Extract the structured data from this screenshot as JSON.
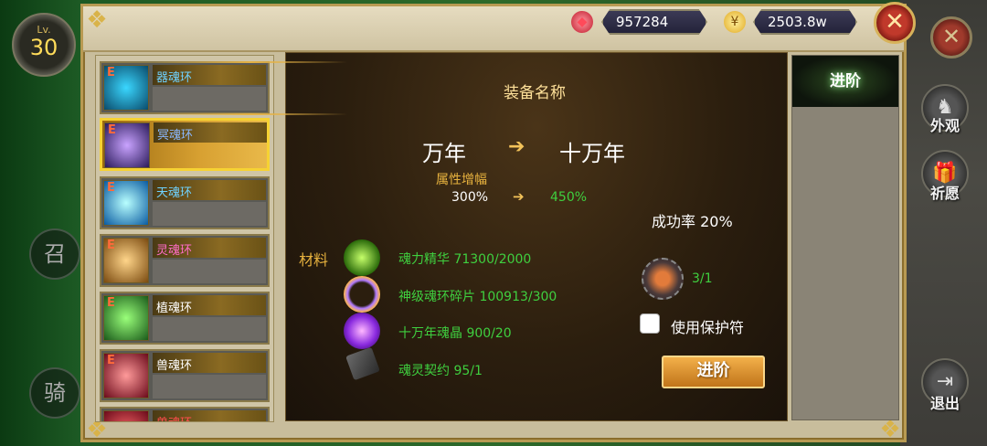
{
  "player": {
    "level_label": "Lv.",
    "level": "30"
  },
  "left_buttons": {
    "summon": "召",
    "ride": "骑"
  },
  "currency": {
    "gems": "957284",
    "gold": "2503.8w"
  },
  "rings": [
    {
      "label": "器魂环",
      "label_color": "#6fd2ff",
      "selected": false
    },
    {
      "label": "冥魂环",
      "label_color": "#8ab8ff",
      "selected": true
    },
    {
      "label": "天魂环",
      "label_color": "#6fd2ff",
      "selected": false
    },
    {
      "label": "灵魂环",
      "label_color": "#ff6cc8",
      "selected": false
    },
    {
      "label": "植魂环",
      "label_color": "#ffffff",
      "selected": false
    },
    {
      "label": "兽魂环",
      "label_color": "#ffffff",
      "selected": false
    },
    {
      "label": "兽魂环",
      "label_color": "#ff4d4d",
      "selected": false
    }
  ],
  "ring_badge": "E",
  "equipment": {
    "name": "装备名称",
    "from_tier": "万年",
    "to_tier": "十万年",
    "attr_label": "属性增幅",
    "attr_from": "300%",
    "attr_to": "450%",
    "success_rate": "成功率 20%"
  },
  "materials": {
    "label": "材料",
    "items": [
      {
        "text": "魂力精华 71300/2000"
      },
      {
        "text": "神级魂环碎片 100913/300"
      },
      {
        "text": "十万年魂晶 900/20"
      },
      {
        "text": "魂灵契约 95/1"
      }
    ]
  },
  "protection": {
    "count": "3/1",
    "checkbox_label": "使用保护符"
  },
  "advance_button": "进阶",
  "right_tabs": {
    "active": "进阶"
  },
  "right_menu": {
    "appearance": "外观",
    "wish": "祈愿",
    "exit": "退出"
  },
  "colors": {
    "green_text": "#3fcf3f",
    "gold_text": "#e7b23e",
    "accent_button": "#e8992e"
  }
}
